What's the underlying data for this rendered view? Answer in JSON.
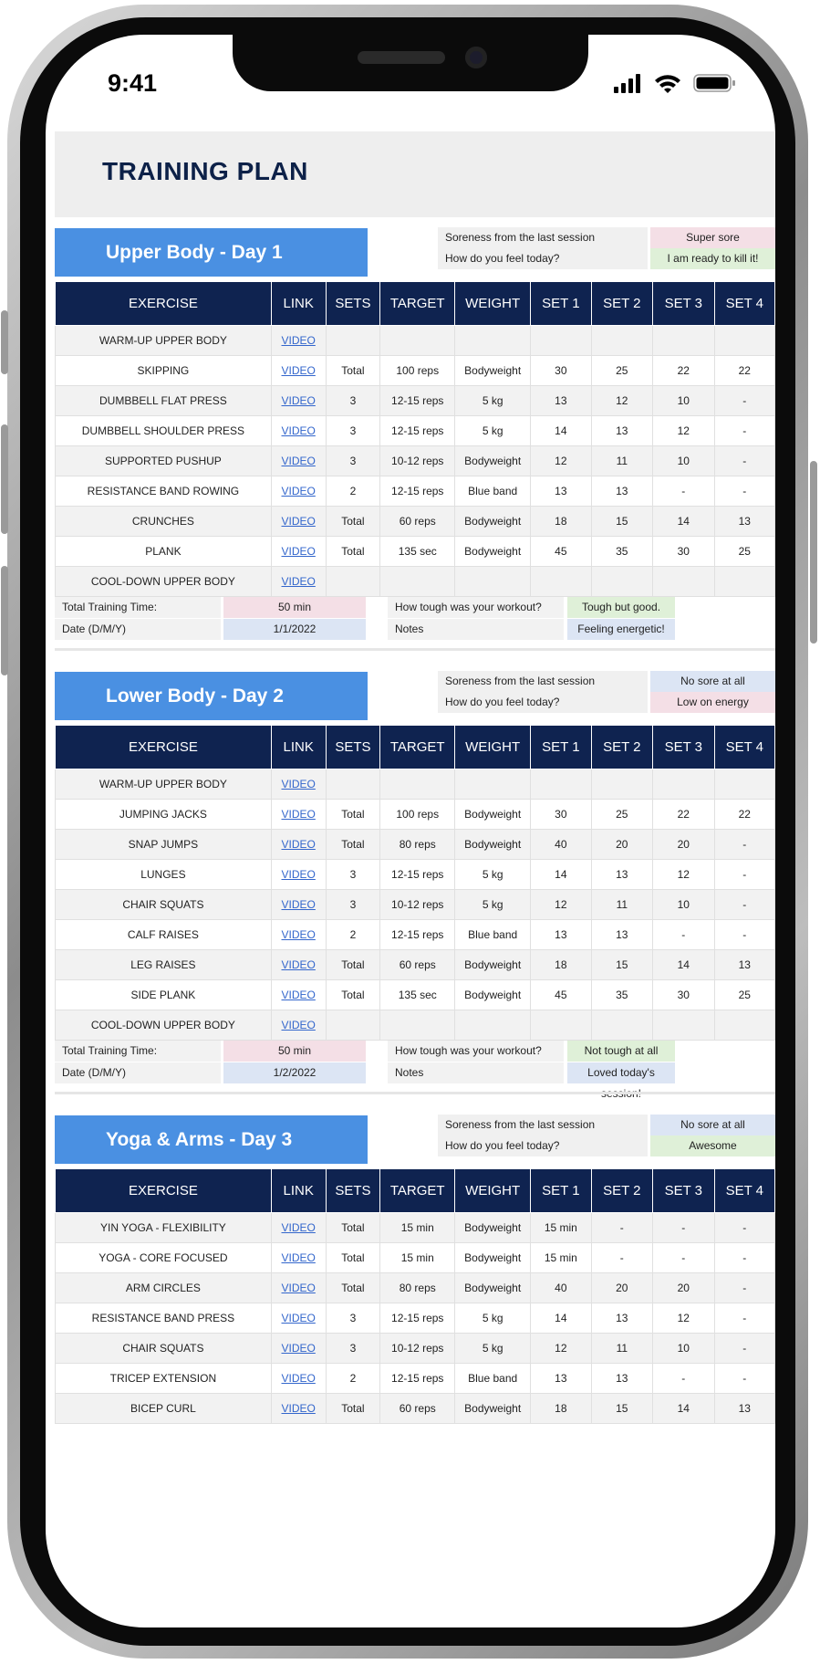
{
  "status": {
    "time": "9:41"
  },
  "title": "TRAINING PLAN",
  "headers": [
    "EXERCISE",
    "LINK",
    "SETS",
    "TARGET",
    "WEIGHT",
    "SET 1",
    "SET 2",
    "SET 3",
    "SET 4"
  ],
  "days": [
    {
      "title": "Upper Body - Day 1",
      "soreness_label": "Soreness from the last session",
      "soreness": "Super sore",
      "soreness_color": "pink",
      "feel_label": "How do you feel today?",
      "feel": "I am ready to kill it!",
      "feel_color": "green",
      "rows": [
        [
          "WARM-UP UPPER BODY",
          "VIDEO",
          "",
          "",
          "",
          "",
          "",
          "",
          ""
        ],
        [
          "SKIPPING",
          "VIDEO",
          "Total",
          "100 reps",
          "Bodyweight",
          "30",
          "25",
          "22",
          "22"
        ],
        [
          "DUMBBELL FLAT PRESS",
          "VIDEO",
          "3",
          "12-15 reps",
          "5 kg",
          "13",
          "12",
          "10",
          "-"
        ],
        [
          "DUMBBELL SHOULDER PRESS",
          "VIDEO",
          "3",
          "12-15 reps",
          "5 kg",
          "14",
          "13",
          "12",
          "-"
        ],
        [
          "SUPPORTED PUSHUP",
          "VIDEO",
          "3",
          "10-12 reps",
          "Bodyweight",
          "12",
          "11",
          "10",
          "-"
        ],
        [
          "RESISTANCE BAND ROWING",
          "VIDEO",
          "2",
          "12-15 reps",
          "Blue band",
          "13",
          "13",
          "-",
          "-"
        ],
        [
          "CRUNCHES",
          "VIDEO",
          "Total",
          "60 reps",
          "Bodyweight",
          "18",
          "15",
          "14",
          "13"
        ],
        [
          "PLANK",
          "VIDEO",
          "Total",
          "135 sec",
          "Bodyweight",
          "45",
          "35",
          "30",
          "25"
        ],
        [
          "COOL-DOWN UPPER BODY",
          "VIDEO",
          "",
          "",
          "",
          "",
          "",
          "",
          ""
        ]
      ],
      "time_label": "Total Training Time:",
      "time": "50 min",
      "date_label": "Date (D/M/Y)",
      "date": "1/1/2022",
      "tough_label": "How tough was your workout?",
      "tough": "Tough but good.",
      "tough_color": "green",
      "notes_label": "Notes",
      "notes": "Feeling energetic!",
      "notes_color": "blue"
    },
    {
      "title": "Lower Body - Day 2",
      "soreness_label": "Soreness from the last session",
      "soreness": "No sore at all",
      "soreness_color": "blue",
      "feel_label": "How do you feel today?",
      "feel": "Low on energy",
      "feel_color": "pink",
      "rows": [
        [
          "WARM-UP UPPER BODY",
          "VIDEO",
          "",
          "",
          "",
          "",
          "",
          "",
          ""
        ],
        [
          "JUMPING JACKS",
          "VIDEO",
          "Total",
          "100 reps",
          "Bodyweight",
          "30",
          "25",
          "22",
          "22"
        ],
        [
          "SNAP JUMPS",
          "VIDEO",
          "Total",
          "80 reps",
          "Bodyweight",
          "40",
          "20",
          "20",
          "-"
        ],
        [
          "LUNGES",
          "VIDEO",
          "3",
          "12-15 reps",
          "5 kg",
          "14",
          "13",
          "12",
          "-"
        ],
        [
          "CHAIR SQUATS",
          "VIDEO",
          "3",
          "10-12 reps",
          "5 kg",
          "12",
          "11",
          "10",
          "-"
        ],
        [
          "CALF RAISES",
          "VIDEO",
          "2",
          "12-15 reps",
          "Blue band",
          "13",
          "13",
          "-",
          "-"
        ],
        [
          "LEG RAISES",
          "VIDEO",
          "Total",
          "60 reps",
          "Bodyweight",
          "18",
          "15",
          "14",
          "13"
        ],
        [
          "SIDE PLANK",
          "VIDEO",
          "Total",
          "135 sec",
          "Bodyweight",
          "45",
          "35",
          "30",
          "25"
        ],
        [
          "COOL-DOWN UPPER BODY",
          "VIDEO",
          "",
          "",
          "",
          "",
          "",
          "",
          ""
        ]
      ],
      "time_label": "Total Training Time:",
      "time": "50 min",
      "date_label": "Date (D/M/Y)",
      "date": "1/2/2022",
      "tough_label": "How tough was your workout?",
      "tough": "Not tough at all",
      "tough_color": "green",
      "notes_label": "Notes",
      "notes": "Loved today's session!",
      "notes_color": "blue"
    },
    {
      "title": "Yoga & Arms - Day 3",
      "soreness_label": "Soreness from the last session",
      "soreness": "No sore at all",
      "soreness_color": "blue",
      "feel_label": "How do you feel today?",
      "feel": "Awesome",
      "feel_color": "green",
      "rows": [
        [
          "YIN YOGA - FLEXIBILITY",
          "VIDEO",
          "Total",
          "15 min",
          "Bodyweight",
          "15 min",
          "-",
          "-",
          "-"
        ],
        [
          "YOGA - CORE FOCUSED",
          "VIDEO",
          "Total",
          "15 min",
          "Bodyweight",
          "15 min",
          "-",
          "-",
          "-"
        ],
        [
          "ARM CIRCLES",
          "VIDEO",
          "Total",
          "80 reps",
          "Bodyweight",
          "40",
          "20",
          "20",
          "-"
        ],
        [
          "RESISTANCE BAND PRESS",
          "VIDEO",
          "3",
          "12-15 reps",
          "5 kg",
          "14",
          "13",
          "12",
          "-"
        ],
        [
          "CHAIR SQUATS",
          "VIDEO",
          "3",
          "10-12 reps",
          "5 kg",
          "12",
          "11",
          "10",
          "-"
        ],
        [
          "TRICEP EXTENSION",
          "VIDEO",
          "2",
          "12-15 reps",
          "Blue band",
          "13",
          "13",
          "-",
          "-"
        ],
        [
          "BICEP CURL",
          "VIDEO",
          "Total",
          "60 reps",
          "Bodyweight",
          "18",
          "15",
          "14",
          "13"
        ]
      ]
    }
  ]
}
